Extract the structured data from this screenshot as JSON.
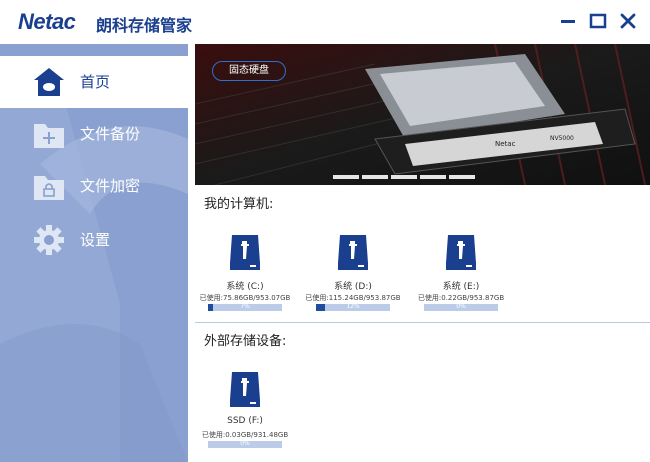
{
  "app": {
    "logo": "Netac",
    "title": "朗科存储管家"
  },
  "window_controls": [
    "minimize",
    "maximize",
    "close"
  ],
  "sidebar": {
    "items": [
      {
        "label": "首页",
        "icon": "home-icon",
        "active": true
      },
      {
        "label": "文件备份",
        "icon": "folder-plus-icon",
        "active": false
      },
      {
        "label": "文件加密",
        "icon": "folder-lock-icon",
        "active": false
      },
      {
        "label": "设置",
        "icon": "gear-icon",
        "active": false
      }
    ]
  },
  "banner": {
    "badge": "固态硬盘",
    "product_text": "NV5000",
    "dots": 5
  },
  "my_computer": {
    "title": "我的计算机:",
    "drives": [
      {
        "name": "系统 (C:)",
        "usage": "已使用:75.86GB/953.07GB",
        "percent": 7,
        "percent_label": "7%"
      },
      {
        "name": "系统 (D:)",
        "usage": "已使用:115.24GB/953.87GB",
        "percent": 12,
        "percent_label": "12%"
      },
      {
        "name": "系统 (E:)",
        "usage": "已使用:0.22GB/953.87GB",
        "percent": 0,
        "percent_label": "0%"
      }
    ]
  },
  "external": {
    "title": "外部存储设备:",
    "drives": [
      {
        "name": "SSD (F:)",
        "usage": "已使用:0.03GB/931.48GB",
        "percent": 0,
        "percent_label": "0%"
      }
    ]
  },
  "colors": {
    "brand": "#1b3f8f",
    "sidebar": "#8aa0d0",
    "bar_fill": "#1d4d9c",
    "bar_bg": "#bccce8"
  }
}
